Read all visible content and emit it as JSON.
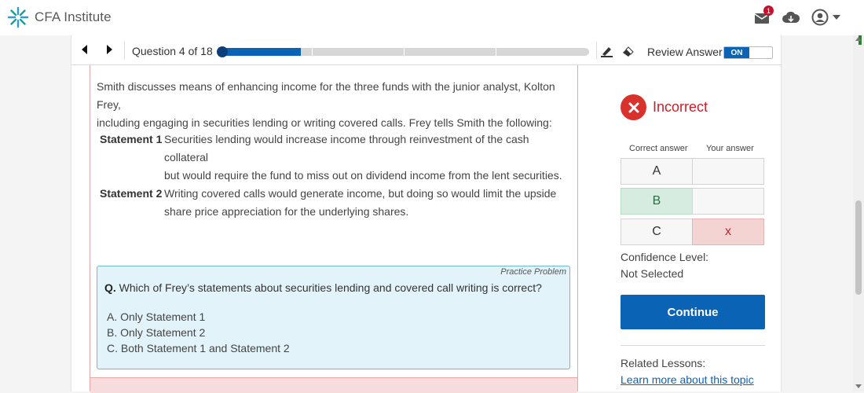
{
  "header": {
    "brand": "CFA Institute",
    "icons": [
      "logo-icon",
      "inbox-icon",
      "cloud-download-icon",
      "account-icon",
      "chevron-down-icon"
    ],
    "notification_count": "1"
  },
  "nav": {
    "question_label": "Question 4 of 18",
    "progress_fraction": 0.22,
    "segments": 4,
    "review_label": "Review Answer",
    "toggle_label": "ON"
  },
  "content": {
    "intro_line1": "Smith discusses means of enhancing income for the three funds with the junior analyst, Kolton Frey,",
    "intro_line2": "including engaging in securities lending or writing covered calls. Frey tells Smith the following:",
    "statements": [
      {
        "label": "Statement 1",
        "line1": "Securities lending would increase income through reinvestment of the cash collateral",
        "line2": "but would require the fund to miss out on dividend income from the lent securities."
      },
      {
        "label": "Statement 2",
        "line1": "Writing covered calls would generate income, but doing so would limit the upside",
        "line2": "share price appreciation for the underlying shares."
      }
    ],
    "question": {
      "tag": "Practice Problem",
      "prefix": "Q.",
      "text": "Which of Frey’s statements about securities lending and covered call writing is correct?",
      "options": [
        "A. Only Statement 1",
        "B. Only Statement 2",
        "C. Both Statement 1 and Statement 2"
      ]
    }
  },
  "result": {
    "status": "Incorrect",
    "correct_header": "Correct answer",
    "your_header": "Your answer",
    "rows": [
      {
        "letter": "A",
        "correct": false,
        "mark": ""
      },
      {
        "letter": "B",
        "correct": true,
        "mark": ""
      },
      {
        "letter": "C",
        "correct": false,
        "mark": "x"
      }
    ],
    "confidence_label": "Confidence Level:",
    "confidence_value": "Not Selected",
    "continue_label": "Continue",
    "related_label": "Related Lessons:",
    "related_link": "Learn more about this topic"
  },
  "colors": {
    "accent": "#0b63b6",
    "error": "#d9322d",
    "correct_bg": "#d6ece0",
    "wrong_bg": "#f4d3d3"
  }
}
